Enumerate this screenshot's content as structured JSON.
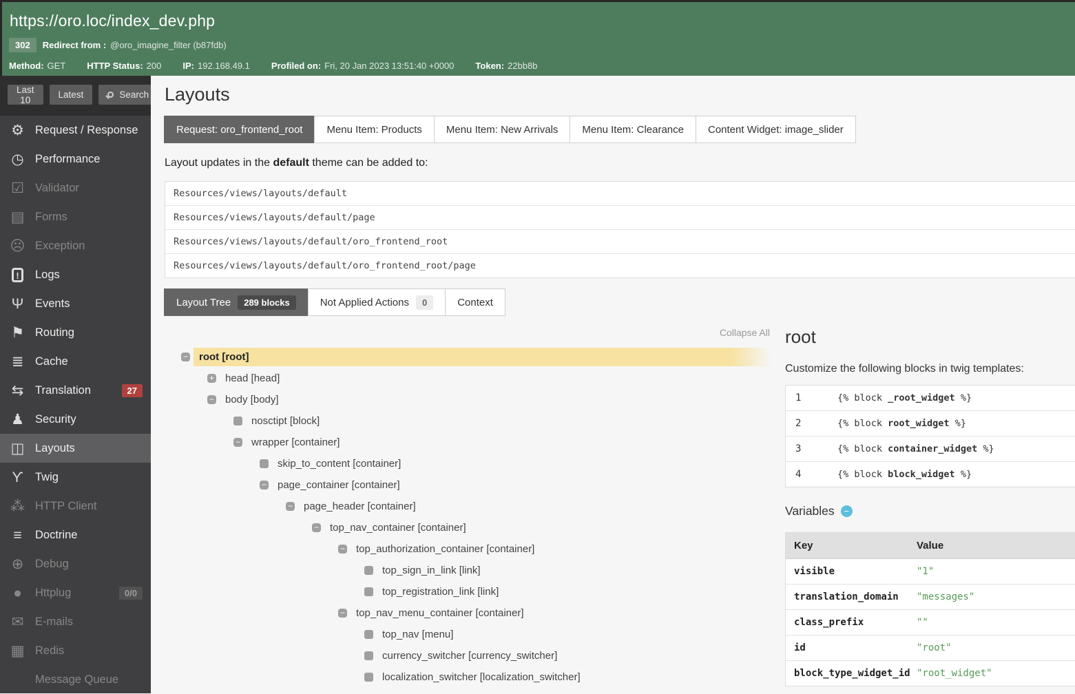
{
  "colors": {
    "header_green": "#4e7d5e",
    "status_badge_green": "#6e9078",
    "translation_badge_red": "#b0413e",
    "active_tab_gray": "#646464",
    "tree_highlight_yellow": "#f7e2a2",
    "variables_button_blue": "#5bc0de",
    "variable_value_green": "#569a56"
  },
  "header": {
    "url": "https://oro.loc/index_dev.php",
    "status_badge": "302",
    "redirect_label": "Redirect from :",
    "redirect_value": "@oro_imagine_filter (b87fdb)",
    "meta": [
      {
        "label": "Method:",
        "value": "GET"
      },
      {
        "label": "HTTP Status:",
        "value": "200"
      },
      {
        "label": "IP:",
        "value": "192.168.49.1"
      },
      {
        "label": "Profiled on:",
        "value": "Fri, 20 Jan 2023 13:51:40 +0000"
      },
      {
        "label": "Token:",
        "value": "22bb8b"
      }
    ]
  },
  "sidebar": {
    "buttons": [
      {
        "label": "Last 10",
        "has_icon": false
      },
      {
        "label": "Latest",
        "has_icon": false
      },
      {
        "label": "Search",
        "has_icon": true
      }
    ],
    "items": [
      {
        "label": "Request / Response",
        "icon": "gears-icon",
        "glyph": "⚙",
        "state": "enabled"
      },
      {
        "label": "Performance",
        "icon": "stopwatch-icon",
        "glyph": "◷",
        "state": "enabled"
      },
      {
        "label": "Validator",
        "icon": "checkbox-icon",
        "glyph": "☑",
        "state": "disabled"
      },
      {
        "label": "Forms",
        "icon": "clipboard-icon",
        "glyph": "▤",
        "state": "disabled"
      },
      {
        "label": "Exception",
        "icon": "ghost-icon",
        "glyph": "☹",
        "state": "disabled"
      },
      {
        "label": "Logs",
        "icon": "log-book-icon",
        "glyph": "!",
        "icon_box": true,
        "state": "enabled"
      },
      {
        "label": "Events",
        "icon": "antenna-icon",
        "glyph": "Ψ",
        "state": "enabled"
      },
      {
        "label": "Routing",
        "icon": "signpost-icon",
        "glyph": "⚑",
        "state": "enabled"
      },
      {
        "label": "Cache",
        "icon": "layers-icon",
        "glyph": "≣",
        "state": "enabled"
      },
      {
        "label": "Translation",
        "icon": "translate-icon",
        "glyph": "⇆",
        "state": "enabled",
        "badge": "27",
        "badge_class": "red"
      },
      {
        "label": "Security",
        "icon": "person-icon",
        "glyph": "♟",
        "state": "enabled"
      },
      {
        "label": "Layouts",
        "icon": "layout-icon",
        "glyph": "◫",
        "state": "enabled",
        "active": true
      },
      {
        "label": "Twig",
        "icon": "twig-icon",
        "glyph": "ϒ",
        "state": "enabled"
      },
      {
        "label": "HTTP Client",
        "icon": "network-icon",
        "glyph": "⁂",
        "state": "disabled"
      },
      {
        "label": "Doctrine",
        "icon": "database-icon",
        "glyph": "≡",
        "state": "enabled"
      },
      {
        "label": "Debug",
        "icon": "compass-icon",
        "glyph": "⊕",
        "state": "disabled"
      },
      {
        "label": "Httplug",
        "icon": "elephant-icon",
        "glyph": "●",
        "state": "disabled",
        "badge": "0/0",
        "badge_class": "gray"
      },
      {
        "label": "E-mails",
        "icon": "envelope-icon",
        "glyph": "✉",
        "state": "disabled"
      },
      {
        "label": "Redis",
        "icon": "stack-icon",
        "glyph": "▦",
        "state": "disabled"
      },
      {
        "label": "Message Queue",
        "icon": "queue-icon",
        "glyph": "",
        "state": "disabled"
      }
    ]
  },
  "main": {
    "title": "Layouts",
    "tabs": [
      {
        "label": "Request: oro_frontend_root",
        "active": true
      },
      {
        "label": "Menu Item: Products"
      },
      {
        "label": "Menu Item: New Arrivals"
      },
      {
        "label": "Menu Item: Clearance"
      },
      {
        "label": "Content Widget: image_slider"
      }
    ],
    "theme_note": {
      "prefix": "Layout updates in the ",
      "theme": "default",
      "suffix": " theme can be added to:"
    },
    "resources": [
      "Resources/views/layouts/default",
      "Resources/views/layouts/default/page",
      "Resources/views/layouts/default/oro_frontend_root",
      "Resources/views/layouts/default/oro_frontend_root/page"
    ],
    "tree_tabs": [
      {
        "label": "Layout Tree",
        "badge": "289 blocks",
        "active": true
      },
      {
        "label": "Not Applied Actions",
        "badge": "0"
      },
      {
        "label": "Context"
      }
    ],
    "collapse_all": "Collapse All",
    "tree": [
      {
        "name": "root",
        "type_bracketed": "[root]",
        "level": 0,
        "toggle": "minus",
        "highlight": true
      },
      {
        "name": "head",
        "type_bracketed": "[head]",
        "level": 1,
        "toggle": "plus"
      },
      {
        "name": "body",
        "type_bracketed": "[body]",
        "level": 1,
        "toggle": "minus"
      },
      {
        "name": "nosctipt",
        "type_bracketed": "[block]",
        "level": 2,
        "toggle": "leaf"
      },
      {
        "name": "wrapper",
        "type_bracketed": "[container]",
        "level": 2,
        "toggle": "minus"
      },
      {
        "name": "skip_to_content",
        "type_bracketed": "[container]",
        "level": 3,
        "toggle": "leaf"
      },
      {
        "name": "page_container",
        "type_bracketed": "[container]",
        "level": 3,
        "toggle": "minus"
      },
      {
        "name": "page_header",
        "type_bracketed": "[container]",
        "level": 4,
        "toggle": "minus"
      },
      {
        "name": "top_nav_container",
        "type_bracketed": "[container]",
        "level": 5,
        "toggle": "minus"
      },
      {
        "name": "top_authorization_container",
        "type_bracketed": "[container]",
        "level": 6,
        "toggle": "minus"
      },
      {
        "name": "top_sign_in_link",
        "type_bracketed": "[link]",
        "level": 7,
        "toggle": "leaf"
      },
      {
        "name": "top_registration_link",
        "type_bracketed": "[link]",
        "level": 7,
        "toggle": "leaf"
      },
      {
        "name": "top_nav_menu_container",
        "type_bracketed": "[container]",
        "level": 6,
        "toggle": "minus"
      },
      {
        "name": "top_nav",
        "type_bracketed": "[menu]",
        "level": 7,
        "toggle": "leaf"
      },
      {
        "name": "currency_switcher",
        "type_bracketed": "[currency_switcher]",
        "level": 7,
        "toggle": "leaf"
      },
      {
        "name": "localization_switcher",
        "type_bracketed": "[localization_switcher]",
        "level": 7,
        "toggle": "leaf"
      }
    ]
  },
  "details": {
    "title": "root",
    "subtitle": "Customize the following blocks in twig templates:",
    "blocks": [
      {
        "num": "1",
        "prefix": "{% block ",
        "name": "_root_widget",
        "suffix": " %}"
      },
      {
        "num": "2",
        "prefix": "{% block ",
        "name": "root_widget",
        "suffix": " %}"
      },
      {
        "num": "3",
        "prefix": "{% block ",
        "name": "container_widget",
        "suffix": " %}"
      },
      {
        "num": "4",
        "prefix": "{% block ",
        "name": "block_widget",
        "suffix": " %}"
      }
    ],
    "variables_title": "Variables",
    "variables_table": {
      "key_header": "Key",
      "value_header": "Value",
      "rows": [
        {
          "key": "visible",
          "value": "\"1\""
        },
        {
          "key": "translation_domain",
          "value": "\"messages\""
        },
        {
          "key": "class_prefix",
          "value": "\"\""
        },
        {
          "key": "id",
          "value": "\"root\""
        },
        {
          "key": "block_type_widget_id",
          "value": "\"root_widget\""
        }
      ]
    }
  }
}
